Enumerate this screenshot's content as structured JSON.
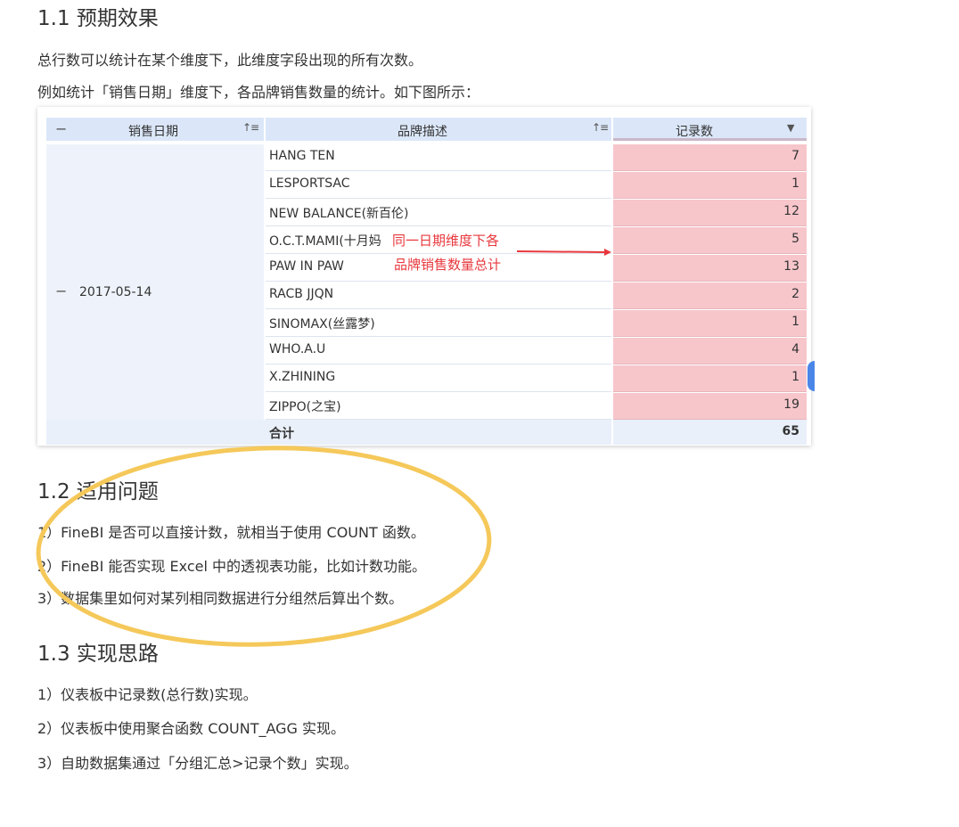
{
  "sections": {
    "s1_title": "1.1 预期效果",
    "s1_p1": "总行数可以统计在某个维度下，此维度字段出现的所有次数。",
    "s1_p2": "例如统计「销售日期」维度下，各品牌销售数量的统计。如下图所示：",
    "s2_title": "1.2 适用问题",
    "s2_items": [
      "1）FineBI 是否可以直接计数，就相当于使用 COUNT 函数。",
      "2）FineBI 能否实现 Excel 中的透视表功能，比如计数功能。",
      "3）数据集里如何对某列相同数据进行分组然后算出个数。"
    ],
    "s3_title": "1.3 实现思路",
    "s3_items": [
      "1）仪表板中记录数(总行数)实现。",
      "2）仪表板中使用聚合函数 COUNT_AGG 实现。",
      "3）自助数据集通过「分组汇总>记录个数」实现。"
    ]
  },
  "table": {
    "headers": [
      "销售日期",
      "品牌描述",
      "记录数"
    ],
    "collapse_symbol": "−",
    "date": "2017-05-14",
    "rows": [
      {
        "brand": "HANG TEN",
        "count": "7"
      },
      {
        "brand": "LESPORTSAC",
        "count": "1"
      },
      {
        "brand": "NEW BALANCE(新百伦)",
        "count": "12"
      },
      {
        "brand": "O.C.T.MAMI(十月妈",
        "count": "5"
      },
      {
        "brand": "PAW IN PAW",
        "count": "13"
      },
      {
        "brand": "RACB JJQN",
        "count": "2"
      },
      {
        "brand": "SINOMAX(丝露梦)",
        "count": "1"
      },
      {
        "brand": "WHO.A.U",
        "count": "4"
      },
      {
        "brand": "X.ZHINING",
        "count": "1"
      },
      {
        "brand": "ZIPPO(之宝)",
        "count": "19"
      }
    ],
    "total_label": "合计",
    "total_value": "65",
    "annotation_line1": "同一日期维度下各",
    "annotation_line2": "品牌销售数量总计"
  },
  "colors": {
    "header_bg": "#dbe7f8",
    "count_highlight": "#f7c6cb",
    "annotation": "#e8383d",
    "circle": "#f5c85a"
  }
}
